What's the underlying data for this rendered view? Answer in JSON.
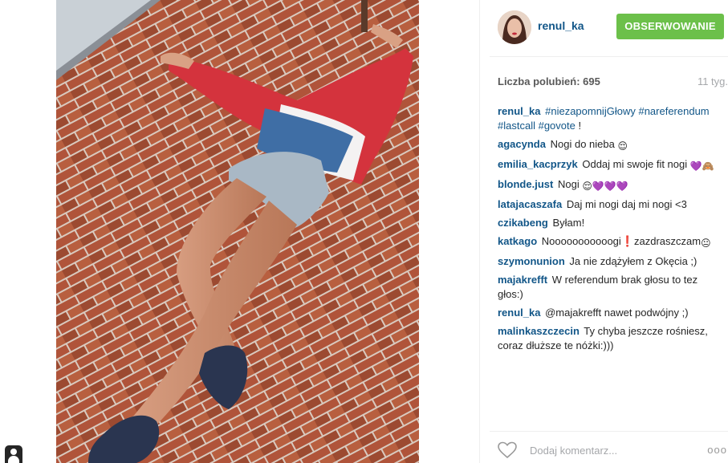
{
  "post": {
    "username": "renul_ka",
    "follow_label": "OBSERWOWANIE",
    "likes_label": "Liczba polubień: 695",
    "time_label": "11 tyg.",
    "caption": {
      "user": "renul_ka",
      "tags": [
        "#niezapomnijGłowy",
        "#nareferendum",
        "#lastcall",
        "#govote"
      ],
      "suffix": "!"
    }
  },
  "comments": [
    {
      "user": "agacynda",
      "text": "Nogi do nieba",
      "emoji": "😌"
    },
    {
      "user": "emilia_kacprzyk",
      "text": "Oddaj mi swoje fit nogi",
      "emoji": "💜🙈"
    },
    {
      "user": "blonde.just",
      "text": "Nogi",
      "emoji": "😌💜💜💜"
    },
    {
      "user": "latajacaszafa",
      "text": "Daj mi nogi daj mi nogi <3",
      "emoji": ""
    },
    {
      "user": "czikabeng",
      "text": "Byłam!",
      "emoji": ""
    },
    {
      "user": "katkago",
      "text": "Nooooooooooogi❗zazdraszczam",
      "emoji": "😐"
    },
    {
      "user": "szymonunion",
      "text": "Ja nie zdążyłem z Okęcia ;)",
      "emoji": ""
    },
    {
      "user": "majakrefft",
      "text": "W referendum brak głosu to tez głos:)",
      "emoji": ""
    },
    {
      "user": "renul_ka",
      "text": "@majakrefft nawet podwójny ;)",
      "emoji": ""
    },
    {
      "user": "malinkaszczecin",
      "text": "Ty chyba jeszcze rośniesz, coraz dłuższe te nóżki:)))",
      "emoji": ""
    }
  ],
  "footer": {
    "placeholder": "Dodaj komentarz...",
    "more_label": "ooo"
  },
  "icons": {
    "like": "heart-icon",
    "more": "more-options-icon",
    "profile_corner": "user-icon"
  },
  "colors": {
    "link": "#125688",
    "follow_button": "#6cc04a",
    "muted": "#a5a7aa"
  }
}
